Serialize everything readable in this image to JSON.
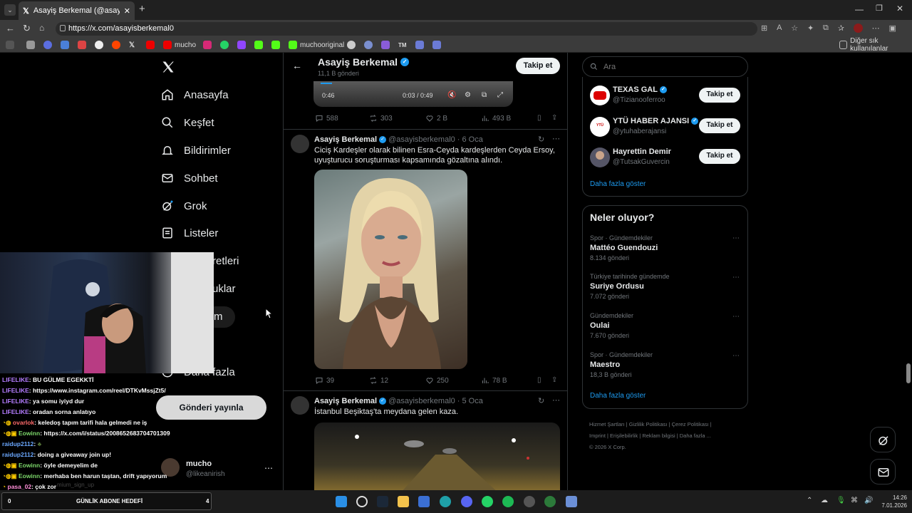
{
  "browser": {
    "tab_title": "Asayiş Berkemal (@asayisberkemal0",
    "url": "https://x.com/asayisberkemal0",
    "bookmarks": [
      "mucho",
      "muchooriginal"
    ],
    "other_favorites": "Diğer sık kullanılanlar"
  },
  "nav": {
    "items": [
      "Anasayfa",
      "Keşfet",
      "Bildirimler",
      "Sohbet",
      "Grok",
      "Listeler",
      "retleri",
      "uklar",
      "m",
      "Daha fazla"
    ],
    "post_button": "Gönderi yayınla",
    "account_name": "mucho",
    "account_handle": "@likeanirish"
  },
  "header": {
    "name": "Asayiş Berkemal",
    "posts": "11,1 B gönderi",
    "follow": "Takip et"
  },
  "video": {
    "time_left": "0:46",
    "time": "0:03 / 0:49"
  },
  "post0": {
    "replies": "588",
    "reposts": "303",
    "likes": "2 B",
    "views": "493 B"
  },
  "post1": {
    "name": "Asayiş Berkemal",
    "handle": "@asayisberkemal0",
    "date": "· 6 Oca",
    "text": "Ciciş Kardeşler olarak bilinen Esra-Ceyda kardeşlerden Ceyda Ersoy, uyuşturucu soruşturması kapsamında gözaltına alındı.",
    "replies": "39",
    "reposts": "12",
    "likes": "250",
    "views": "78 B"
  },
  "post2": {
    "name": "Asayiş Berkemal",
    "handle": "@asayisberkemal0",
    "date": "· 5 Oca",
    "text": "İstanbul Beşiktaş'ta meydana gelen kaza."
  },
  "search": {
    "placeholder": "Ara"
  },
  "who_to_follow": {
    "accounts": [
      {
        "name": "TEXAS GAL",
        "handle": "@Tizianooferroo",
        "button": "Takip et"
      },
      {
        "name": "YTÜ HABER AJANSI",
        "handle": "@ytuhaberajansi",
        "button": "Takip et"
      },
      {
        "name": "Hayrettin Demir",
        "handle": "@TutsakGuvercin",
        "button": "Takip et"
      }
    ],
    "show_more": "Daha fazla göster"
  },
  "trends": {
    "title": "Neler oluyor?",
    "items": [
      {
        "category": "Spor · Gündemdekiler",
        "title": "Mattéo Guendouzi",
        "count": "8.134 gönderi"
      },
      {
        "category": "Türkiye tarihinde gündemde",
        "title": "Suriye Ordusu",
        "count": "7.072 gönderi"
      },
      {
        "category": "Gündemdekiler",
        "title": "Oulai",
        "count": "7.670 gönderi"
      },
      {
        "category": "Spor · Gündemdekiler",
        "title": "Maestro",
        "count": "18,3 B gönderi"
      }
    ],
    "show_more": "Daha fazla göster"
  },
  "footer": {
    "links": [
      "Hizmet Şartları",
      "Gizlilik Politikası",
      "Çerez Politikası",
      "Imprint",
      "Erişilebilirlik",
      "Reklam bilgisi",
      "Daha fazla ..."
    ],
    "copyright": "© 2026 X Corp."
  },
  "stream_chat": {
    "messages": [
      {
        "user": "LIFELIKE",
        "text": ": BU GÜLME EGEKKTİ",
        "color": "#b47cff"
      },
      {
        "user": "LIFELIKE",
        "text": ": https://www.instagram.com/reel/DTKvMssjZt5/",
        "color": "#b47cff"
      },
      {
        "user": "LIFELIKE",
        "text": ": ya somu iyiyd dur",
        "color": "#b47cff"
      },
      {
        "user": "LIFELIKE",
        "text": ": oradan sorna anlatıyo",
        "color": "#b47cff"
      },
      {
        "user": "ovarlok",
        "text": ": keledoş tapım tarifi hala gelmedi ne iş",
        "color": "#ff6b6b"
      },
      {
        "user": "Eowinn",
        "text": ": https://x.com/i/status/2008652683704701309",
        "color": "#7dd86b"
      },
      {
        "user": "raidup2112",
        "text": ":",
        "color": "#6ba8ff"
      },
      {
        "user": "raidup2112",
        "text": ": doing a giveaway join up!",
        "color": "#6ba8ff"
      },
      {
        "user": "Eowinn",
        "text": ": öyle demeyelim de",
        "color": "#7dd86b"
      },
      {
        "user": "Eowinn",
        "text": ": merhaba ben harun taştan, drift yapıyorum",
        "color": "#7dd86b"
      },
      {
        "user": "pasa_02",
        "text": ": çok zor",
        "color": "#ff8fd8"
      }
    ],
    "goal_label": "GÜNLİK ABONE HEDEFİ",
    "goal_left": "0",
    "goal_right": "4",
    "faded": "mium_sign_up"
  },
  "taskbar": {
    "time": "14:26",
    "date": "7.01.2026"
  },
  "colors": {
    "verified": "#1d9bf0",
    "link": "#1d9bf0",
    "background": "#000000"
  }
}
